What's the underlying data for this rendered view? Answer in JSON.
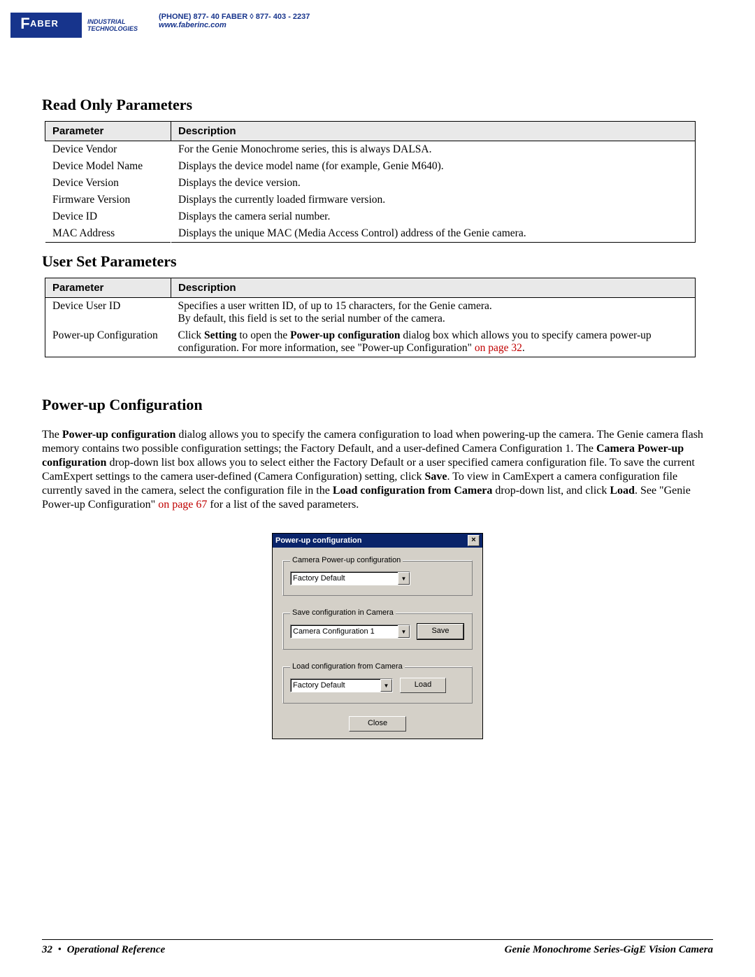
{
  "header": {
    "logo_text": "ABER",
    "logo_f": "F",
    "sideline1": "Industrial",
    "sideline2": "Technologies",
    "phone_line": "(PHONE) 877- 40 FABER  ◊  877- 403 - 2237",
    "url": "www.faberinc.com"
  },
  "sections": {
    "readonly_heading": "Read Only Parameters",
    "userset_heading": "User Set Parameters",
    "powerup_heading": "Power-up Configuration"
  },
  "table_headers": {
    "param": "Parameter",
    "desc": "Description"
  },
  "readonly": [
    {
      "param": "Device Vendor",
      "desc": "For the Genie Monochrome series, this is always DALSA."
    },
    {
      "param": "Device Model Name",
      "desc": "Displays the device model name (for example, Genie M640)."
    },
    {
      "param": "Device Version",
      "desc": "Displays the device version."
    },
    {
      "param": "Firmware Version",
      "desc": "Displays the currently loaded firmware version."
    },
    {
      "param": "Device ID",
      "desc": "Displays the camera serial number."
    },
    {
      "param": "MAC Address",
      "desc": "Displays the unique MAC (Media Access Control) address of the Genie camera."
    }
  ],
  "userset": {
    "row0": {
      "param": "Device User ID",
      "line1": "Specifies a user written ID, of up to 15 characters, for the Genie camera.",
      "line2": "By default, this field is set to the serial number of the camera."
    },
    "row1": {
      "param": "Power-up Configuration",
      "pre": "Click ",
      "b1": "Setting",
      "mid1": " to open the ",
      "b2": "Power-up configuration",
      "mid2": " dialog box which allows you to specify camera power-up configuration. For more information, see \"Power-up Configuration\"",
      "link": " on page 32",
      "end": "."
    }
  },
  "powerup_para": {
    "p1": "The ",
    "b1": "Power-up configuration",
    "p2": " dialog allows you to specify the camera configuration to load when powering-up the camera. The Genie camera flash memory contains two possible configuration settings; the Factory Default, and a user-defined Camera Configuration 1. The ",
    "b2": "Camera Power-up configuration",
    "p3": " drop-down list box allows you to select either the Factory Default or a user specified camera configuration file. To save the current CamExpert settings to the camera user-defined (Camera Configuration) setting, click ",
    "b3": "Save",
    "p4": ". To view in CamExpert a camera configuration file currently saved in the camera, select the configuration file in the ",
    "b4": "Load configuration from Camera",
    "p5": " drop-down list, and click ",
    "b5": "Load",
    "p6": ". See \"Genie Power-up Configuration\"",
    "link": " on page 67",
    "p7": " for a list of the saved parameters."
  },
  "dialog": {
    "title": "Power-up configuration",
    "close": "×",
    "group1": "Camera Power-up configuration",
    "combo1": "Factory Default",
    "group2": "Save configuration in Camera",
    "combo2": "Camera Configuration 1",
    "save_btn": "Save",
    "group3": "Load configuration from Camera",
    "combo3": "Factory Default",
    "load_btn": "Load",
    "close_btn": "Close"
  },
  "footer": {
    "page": "32",
    "section": "Operational Reference",
    "doc": "Genie Monochrome Series-GigE Vision Camera"
  }
}
